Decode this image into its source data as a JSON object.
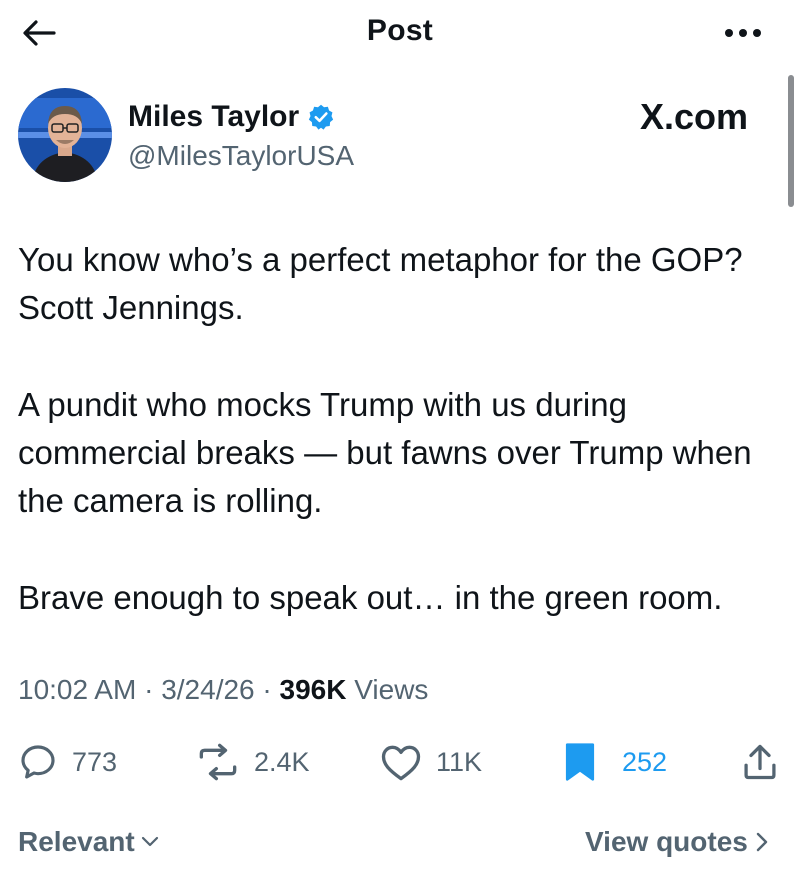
{
  "header": {
    "title": "Post"
  },
  "author": {
    "name": "Miles Taylor",
    "handle": "@MilesTaylorUSA",
    "verified": true
  },
  "watermark": "X.com",
  "tweet": {
    "paragraphs": [
      "You know who’s a perfect metaphor for the GOP? Scott Jennings.",
      "A pundit who mocks Trump with us during commercial breaks — but fawns over Trump when the camera is rolling.",
      "Brave enough to speak out… in the green room."
    ]
  },
  "meta": {
    "time": "10:02 AM",
    "date": "3/24/26",
    "separator": "·",
    "views_count": "396K",
    "views_label": "Views"
  },
  "actions": {
    "replies": "773",
    "reposts": "2.4K",
    "likes": "11K",
    "bookmarks": "252"
  },
  "footer": {
    "sort_label": "Relevant",
    "quotes_label": "View quotes"
  },
  "colors": {
    "text": "#0f1419",
    "secondary": "#536471",
    "accent": "#1d9bf0"
  }
}
